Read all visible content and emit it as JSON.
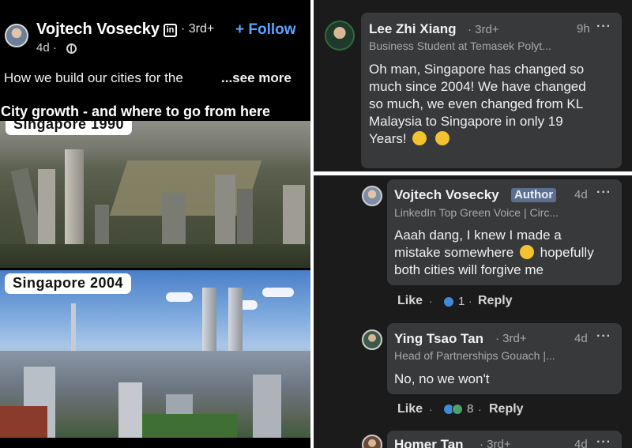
{
  "post": {
    "author": "Vojtech Vosecky",
    "linkedin_icon": "in",
    "degree": "· 3rd+",
    "follow_label": "+ Follow",
    "time": "4d ·",
    "text": "How we build our cities for the",
    "see_more": "...see more",
    "headline": "City growth - and where to go from here",
    "images": [
      {
        "label": "Singapore 1990"
      },
      {
        "label": "Singapore 2004"
      }
    ]
  },
  "comments": [
    {
      "name": "Lee Zhi Xiang",
      "degree": "· 3rd+",
      "subtitle": "Business Student at Temasek Polyt...",
      "time": "9h",
      "more": "···",
      "lines": [
        "Oh man, Singapore has changed so",
        "much since 2004! We have changed",
        "so much, we even changed from KL",
        "Malaysia to Singapore in only 19"
      ],
      "last_line": "Years!"
    },
    {
      "name": "Vojtech Vosecky",
      "badge": "Author",
      "time": "4d",
      "more": "···",
      "subtitle": "LinkedIn Top Green Voice | Circ...",
      "line1": "Aaah dang, I knew I made a",
      "line2a": "mistake somewhere",
      "line2b": "hopefully",
      "line3": "both cities will forgive me",
      "like": "Like",
      "sep": "·",
      "reactions": "1",
      "reply": "Reply"
    },
    {
      "name": "Ying Tsao Tan",
      "degree": "· 3rd+",
      "time": "4d",
      "more": "···",
      "subtitle": "Head of Partnerships Gouach |...",
      "text": "No, no we won't",
      "like": "Like",
      "sep": "·",
      "reactions": "8",
      "reply": "Reply"
    },
    {
      "name": "Homer Tan",
      "degree": "· 3rd+",
      "time": "4d",
      "more": "···"
    }
  ],
  "colors": {
    "follow": "#5aa3ff",
    "bubble": "#38393b",
    "author_badge": "#5d6f8e",
    "like_reaction": "#3f8bd9"
  }
}
